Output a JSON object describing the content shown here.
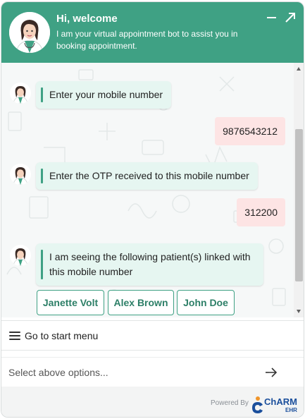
{
  "header": {
    "title": "Hi, welcome",
    "subtitle": "I am your virtual appointment bot to assist you in booking appointment.",
    "minimize_icon": "minimize-icon",
    "expand_icon": "expand-icon"
  },
  "chat": {
    "messages": [
      {
        "from": "bot",
        "text": "Enter your mobile number"
      },
      {
        "from": "user",
        "text": "9876543212"
      },
      {
        "from": "bot",
        "text": "Enter the OTP received to this mobile number"
      },
      {
        "from": "user",
        "text": "312200"
      },
      {
        "from": "bot",
        "text": "I am seeing the following patient(s) linked with this mobile number"
      }
    ],
    "options": [
      "Janette Volt",
      "Alex Brown",
      "John Doe"
    ]
  },
  "menu": {
    "label": "Go to start menu",
    "icon": "hamburger-menu-icon"
  },
  "input": {
    "placeholder": "Select above options...",
    "value": ""
  },
  "footer": {
    "powered_by": "Powered By",
    "brand_main": "ChARM",
    "brand_sub": "EHR"
  },
  "colors": {
    "accent": "#3fa184",
    "bot_bubble": "#e6f6f1",
    "user_bubble": "#fde4e4",
    "brand_blue": "#1b4f9c",
    "brand_orange": "#f0952a"
  }
}
